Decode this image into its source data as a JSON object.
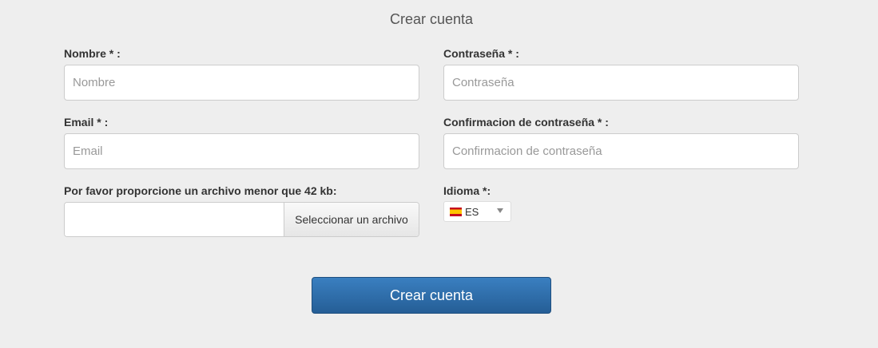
{
  "title": "Crear cuenta",
  "form": {
    "name": {
      "label": "Nombre * :",
      "placeholder": "Nombre",
      "value": ""
    },
    "email": {
      "label": "Email * :",
      "placeholder": "Email",
      "value": ""
    },
    "file": {
      "label": "Por favor proporcione un archivo menor que 42 kb:",
      "button_label": "Seleccionar un archivo"
    },
    "password": {
      "label": "Contraseña * :",
      "placeholder": "Contraseña",
      "value": ""
    },
    "password_confirm": {
      "label": "Confirmacion de contraseña * :",
      "placeholder": "Confirmacion de contraseña",
      "value": ""
    },
    "language": {
      "label": "Idioma *:",
      "selected": "ES",
      "flag_icon": "spain-flag-icon"
    }
  },
  "submit_label": "Crear cuenta",
  "colors": {
    "background": "#eeeeee",
    "primary_button": "#2f6ea8"
  }
}
